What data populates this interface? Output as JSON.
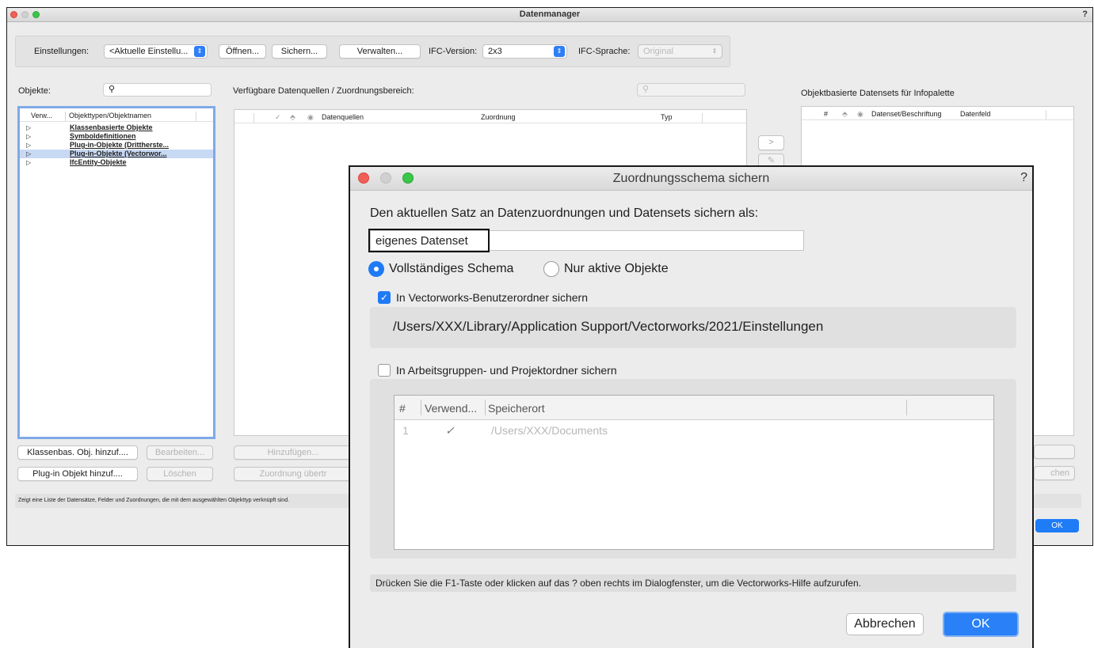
{
  "main": {
    "title": "Datenmanager",
    "help": "?",
    "settings_label": "Einstellungen:",
    "settings_value": "<Aktuelle Einstellu...",
    "open_label": "Öffnen...",
    "save_label": "Sichern...",
    "manage_label": "Verwalten...",
    "ifc_version_label": "IFC-Version:",
    "ifc_version_value": "2x3",
    "ifc_language_label": "IFC-Sprache:",
    "ifc_language_value": "Original",
    "objects_label": "Objekte:",
    "sources_label": "Verfügbare Datenquellen / Zuordnungsbereich:",
    "datasets_label": "Objektbasierte Datensets für Infopalette",
    "objects_table": {
      "col_used": "Verw...",
      "col_name": "Objekttypen/Objektnamen",
      "rows": [
        {
          "arrow": "▷",
          "name": "Klassenbasierte Objekte",
          "selected": false
        },
        {
          "arrow": "▷",
          "name": "Symboldefinitionen",
          "selected": false
        },
        {
          "arrow": "▷",
          "name": "Plug-in-Objekte (Drittherste...",
          "selected": false
        },
        {
          "arrow": "▷",
          "name": "Plug-in-Objekte (Vectorwor...",
          "selected": true
        },
        {
          "arrow": "▷",
          "name": "IfcEntity-Objekte",
          "selected": false
        }
      ]
    },
    "sources_table": {
      "col_source": "Datenquellen",
      "col_mapping": "Zuordnung",
      "col_type": "Typ"
    },
    "datasets_table": {
      "col_num": "#",
      "col_dataset": "Datenset/Beschriftung",
      "col_field": "Datenfeld"
    },
    "add_class_obj": "Klassenbas. Obj. hinzuf....",
    "edit": "Bearbeiten...",
    "add_plugin": "Plug-in Objekt hinzuf....",
    "delete": "Löschen",
    "add": "Hinzufügen...",
    "transfer_mapping": "Zuordnung übertr",
    "delete_right": "chen",
    "move_right": ">",
    "ok": "OK",
    "status": "Zeigt eine Liste der Datensätze, Felder und Zuordnungen, die mit dem ausgewählten Objekttyp verknüpft sind."
  },
  "dialog": {
    "title": "Zuordnungsschema sichern",
    "help": "?",
    "prompt": "Den aktuellen Satz an Datenzuordnungen und Datensets sichern als:",
    "name_value": "eigenes Datenset",
    "radio_full": "Vollständiges Schema",
    "radio_active": "Nur aktive Objekte",
    "check_user_folder": "In Vectorworks-Benutzerordner sichern",
    "user_folder_path": "/Users/XXX/Library/Application Support/Vectorworks/2021/Einstellungen",
    "check_workgroup": "In Arbeitsgruppen- und Projektordner sichern",
    "table": {
      "col_num": "#",
      "col_used": "Verwend...",
      "col_location": "Speicherort",
      "rows": [
        {
          "num": "1",
          "used": "✓",
          "location": "/Users/XXX/Documents"
        }
      ]
    },
    "hint": "Drücken Sie die F1-Taste oder klicken auf das ? oben rechts im Dialogfenster, um die Vectorworks-Hilfe aufzurufen.",
    "cancel": "Abbrechen",
    "ok": "OK"
  },
  "colors": {
    "accent": "#1f7af6",
    "close": "#f25f58",
    "zoom": "#3ac648",
    "selection": "#c8d9f4"
  }
}
